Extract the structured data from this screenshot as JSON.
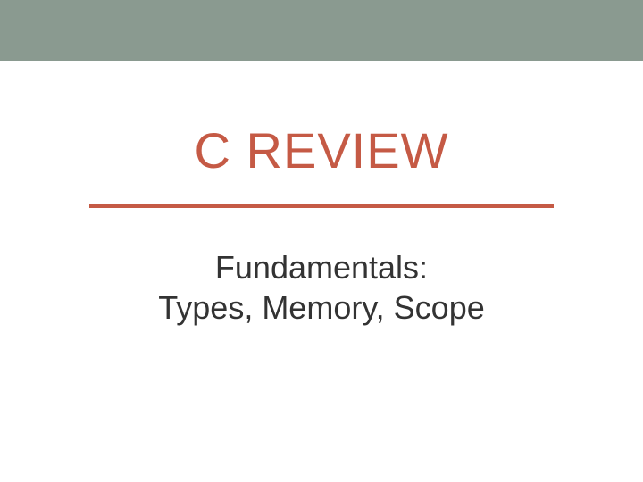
{
  "title": "C REVIEW",
  "subtitle_line1": "Fundamentals:",
  "subtitle_line2": "Types, Memory, Scope"
}
